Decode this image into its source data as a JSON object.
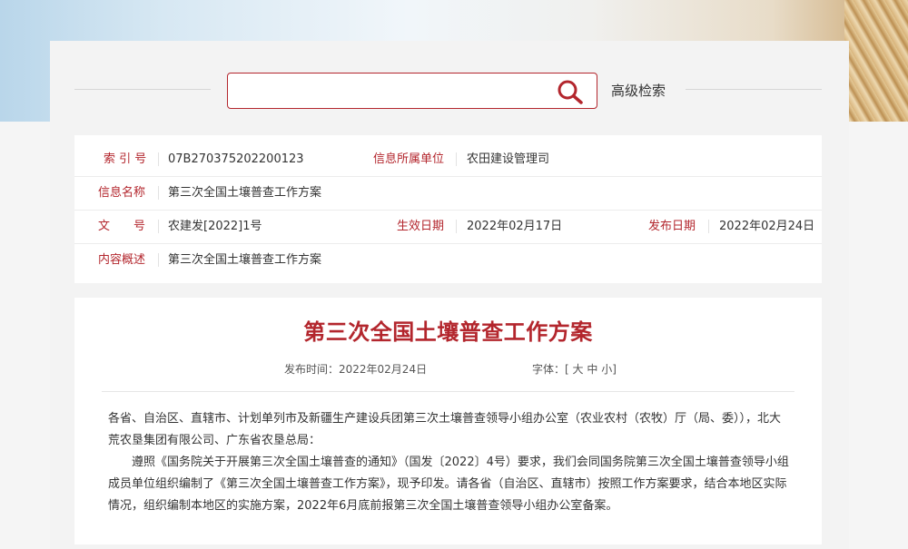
{
  "search": {
    "placeholder": "",
    "value": "",
    "advanced_label": "高级检索"
  },
  "info": {
    "index_label": "索 引 号",
    "index_value": "07B270375202200123",
    "org_label": "信息所属单位",
    "org_value": "农田建设管理司",
    "name_label": "信息名称",
    "name_value": "第三次全国土壤普查工作方案",
    "docno_label": "文　　号",
    "docno_value": "农建发[2022]1号",
    "effective_label": "生效日期",
    "effective_value": "2022年02月17日",
    "publish_label": "发布日期",
    "publish_value": "2022年02月24日",
    "summary_label": "内容概述",
    "summary_value": "第三次全国土壤普查工作方案"
  },
  "article": {
    "title": "第三次全国土壤普查工作方案",
    "publish_time": "发布时间：2022年02月24日",
    "font_label": "字体：[",
    "font_large": "大",
    "font_medium": "中",
    "font_small": "小",
    "font_close": "]",
    "p1_line1": "各省、自治区、直辖市、计划单列市及新疆生产建设兵团第三次土壤普查领导小组办公室（农业农村（农牧）厅（局、委）），北大",
    "p1_line2": "荒农垦集团有限公司、广东省农垦总局：",
    "p2_line1": "　　遵照《国务院关于开展第三次全国土壤普查的通知》（国发〔2022〕4号）要求，我们会同国务院第三次全国土壤普查领导小组",
    "p2_line2": "成员单位组织编制了《第三次全国土壤普查工作方案》，现予印发。请各省（自治区、直辖市）按照工作方案要求，结合本地区实际",
    "p2_line3": "情况，组织编制本地区的实施方案，2022年6月底前报第三次全国土壤普查领导小组办公室备案。"
  },
  "colors": {
    "accent": "#b3262d",
    "background": "#f5f5f5"
  },
  "icons": {
    "search": "search-icon"
  }
}
